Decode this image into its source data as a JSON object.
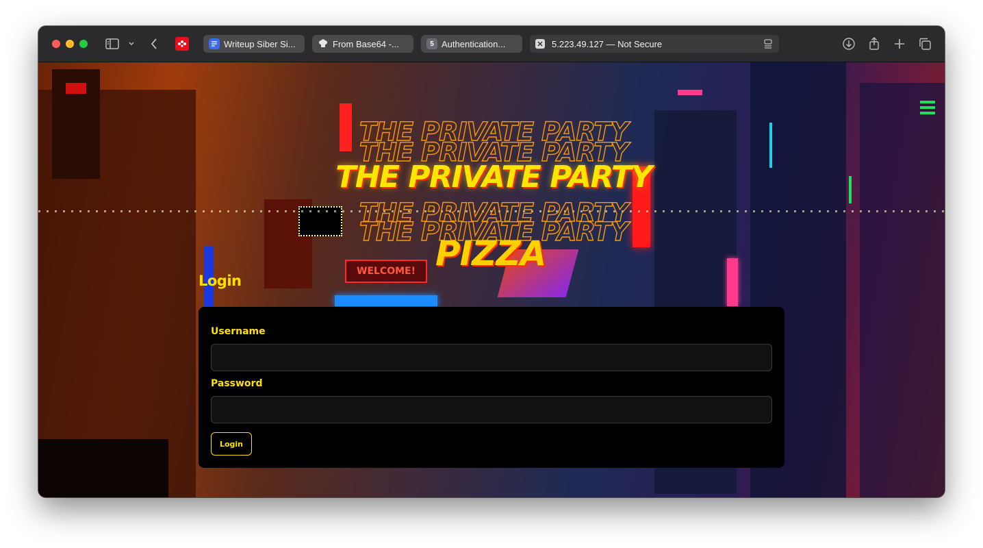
{
  "browser": {
    "tabs": [
      {
        "label": "Writeup Siber Si...",
        "favicon": "doc-icon"
      },
      {
        "label": "From Base64 -...",
        "favicon": "chef-hat-icon"
      },
      {
        "label": "Authentication...",
        "favicon": "number-5-icon",
        "favicon_text": "5"
      }
    ],
    "address": "5.223.49.127 — Not Secure"
  },
  "page": {
    "hero_title": "THE PRIVATE PARTY",
    "hero_subtitle": "PIZZA",
    "sign": "WELCOME!",
    "login_heading": "Login",
    "username_label": "Username",
    "username_value": "",
    "password_label": "Password",
    "password_value": "",
    "login_button": "Login"
  },
  "colors": {
    "accent": "#ffe000",
    "panel": "#000000",
    "input_bg": "#111111"
  }
}
